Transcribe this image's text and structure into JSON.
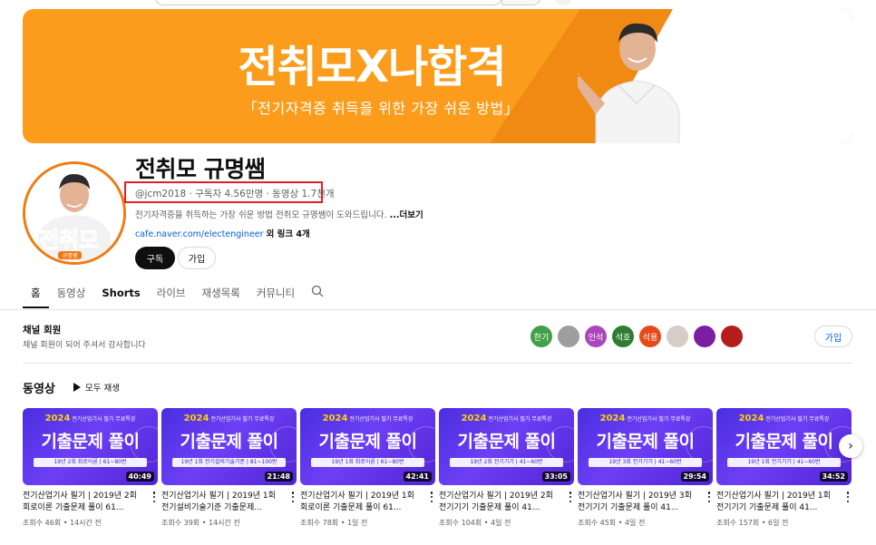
{
  "banner": {
    "title": "전취모X나합격",
    "subtitle": "「전기자격증 취득을 위한 가장 쉬운 방법」"
  },
  "channel": {
    "name": "전취모 규명쌤",
    "avatar_text": "전취모",
    "avatar_badge": "규명쌤",
    "meta": "@jcm2018 · 구독자 4.56만명 · 동영상 1.7천개",
    "description": "전기자격증을 취득하는 가장 쉬운 방법 전취모 규명쌤이 도와드립니다.",
    "description_more": "...더보기",
    "link": "cafe.naver.com/electengineer",
    "link_more": "외 링크 4개",
    "subscribe_label": "구독",
    "join_label": "가입"
  },
  "tabs": [
    "홈",
    "동영상",
    "Shorts",
    "라이브",
    "재생목록",
    "커뮤니티"
  ],
  "membership": {
    "title": "채널 회원",
    "subtitle": "채널 회원이 되어 주셔서 감사합니다",
    "join_label": "가입",
    "avatars": [
      {
        "text": "한기",
        "color": "#43a047"
      },
      {
        "text": "",
        "color": "#9e9e9e"
      },
      {
        "text": "인석",
        "color": "#ab47bc"
      },
      {
        "text": "석호",
        "color": "#2e7d32"
      },
      {
        "text": "석용",
        "color": "#e64a19"
      },
      {
        "text": "",
        "color": "#d7ccc8"
      },
      {
        "text": "",
        "color": "#7b1fa2"
      },
      {
        "text": "",
        "color": "#b71c1c"
      }
    ]
  },
  "videos_section": {
    "title": "동영상",
    "play_all": "모두 재생"
  },
  "videos": [
    {
      "thumb_head": "전기산업기사 필기 무료특강",
      "thumb_year": "2024",
      "thumb_main": "기출문제 풀이",
      "thumb_sub": "19년 2회 회로이론 | 61~80번",
      "duration": "40:49",
      "title": "전기산업기사 필기 | 2019년 2회 회로이론 기출문제 풀이 61...",
      "meta": "조회수 46회 • 14시간 전"
    },
    {
      "thumb_head": "전기산업기사 필기 무료특강",
      "thumb_year": "2024",
      "thumb_main": "기출문제 풀이",
      "thumb_sub": "19년 1회 전기설비기술기준 | 81~100번",
      "duration": "21:48",
      "title": "전기산업기사 필기 | 2019년 1회 전기설비기술기준 기출문제...",
      "meta": "조회수 39회 • 14시간 전"
    },
    {
      "thumb_head": "전기산업기사 필기 무료특강",
      "thumb_year": "2024",
      "thumb_main": "기출문제 풀이",
      "thumb_sub": "19년 1회 회로이론 | 61~80번",
      "duration": "42:41",
      "title": "전기산업기사 필기 | 2019년 1회 회로이론 기출문제 풀이 61...",
      "meta": "조회수 78회 • 1일 전"
    },
    {
      "thumb_head": "전기산업기사 필기 무료특강",
      "thumb_year": "2024",
      "thumb_main": "기출문제 풀이",
      "thumb_sub": "19년 2회 전기기기 | 41~60번",
      "duration": "33:05",
      "title": "전기산업기사 필기 | 2019년 2회 전기기기 기출문제 풀이 41...",
      "meta": "조회수 104회 • 4일 전"
    },
    {
      "thumb_head": "전기산업기사 필기 무료특강",
      "thumb_year": "2024",
      "thumb_main": "기출문제 풀이",
      "thumb_sub": "19년 3회 전기기기 | 41~60번",
      "duration": "29:54",
      "title": "전기산업기사 필기 | 2019년 3회 전기기기 기출문제 풀이 41...",
      "meta": "조회수 45회 • 4일 전"
    },
    {
      "thumb_head": "전기산업기사 필기 무료특강",
      "thumb_year": "2024",
      "thumb_main": "기출문제 풀이",
      "thumb_sub": "19년 1회 전기기기 | 41~60번",
      "duration": "34:52",
      "title": "전기산업기사 필기 | 2019년 1회 전기기기 기출문제 풀이 41...",
      "meta": "조회수 157회 • 6일 전"
    }
  ],
  "colors": {
    "banner_orange": "#fb9c1c",
    "highlight_red": "#e21f26",
    "link_blue": "#065fd4",
    "thumb_purple": "#5a30e6"
  }
}
